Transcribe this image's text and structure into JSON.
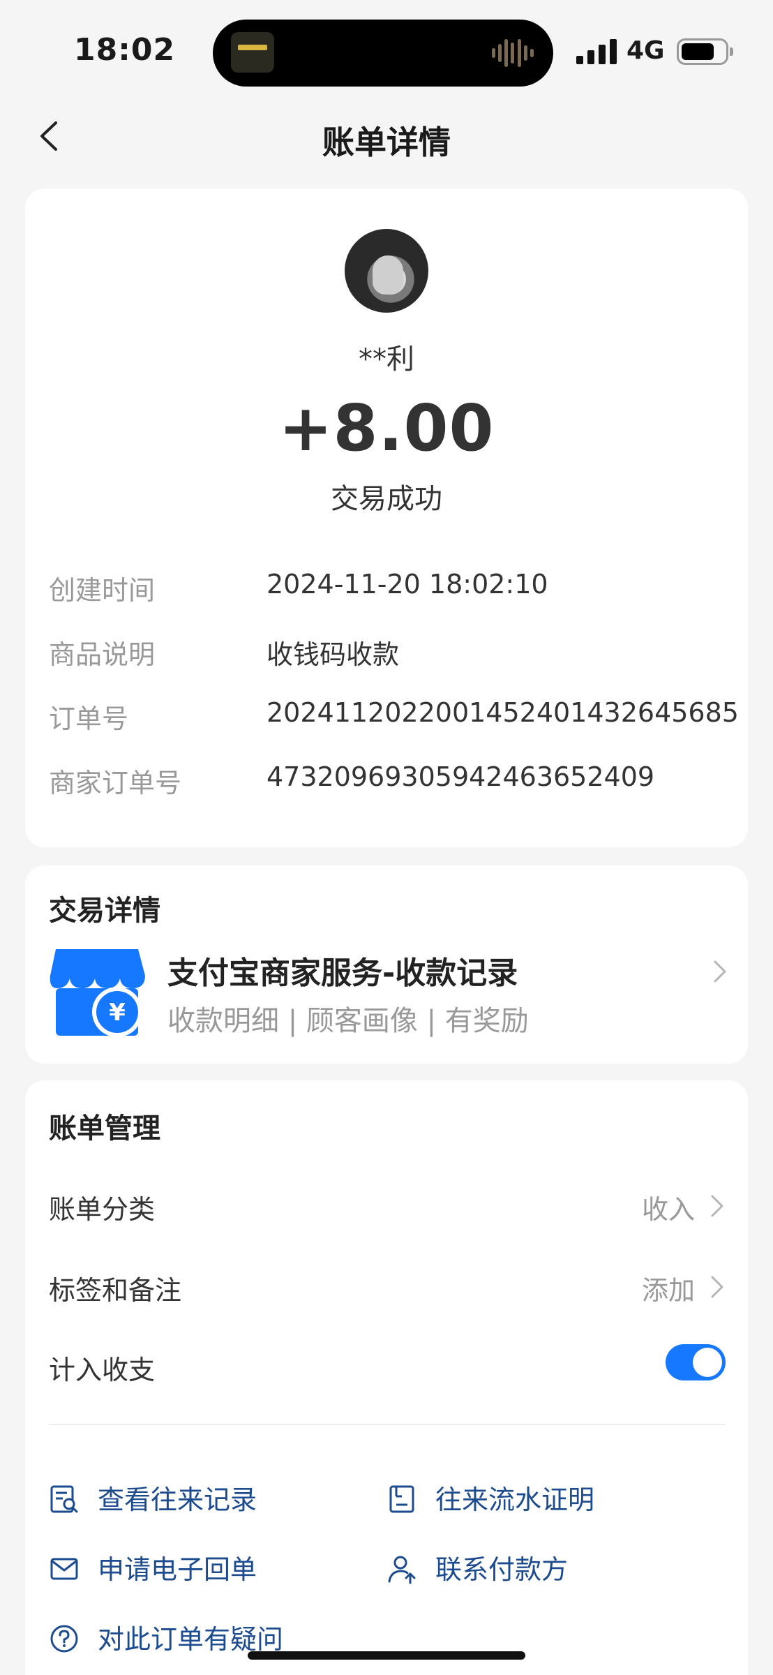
{
  "status_bar": {
    "time": "18:02",
    "network": "4G"
  },
  "nav": {
    "title": "账单详情"
  },
  "summary": {
    "payer": "**利",
    "amount": "+8.00",
    "status": "交易成功"
  },
  "details": [
    {
      "label": "创建时间",
      "value": "2024-11-20 18:02:10"
    },
    {
      "label": "商品说明",
      "value": "收钱码收款"
    },
    {
      "label": "订单号",
      "value": "2024112022001452401432645685"
    },
    {
      "label": "商家订单号",
      "value": "4732096930594246365240​9"
    }
  ],
  "trade": {
    "section_title": "交易详情",
    "service_title": "支付宝商家服务-收款记录",
    "service_sub": "收款明细 | 顾客画像 | 有奖励"
  },
  "manage": {
    "section_title": "账单管理",
    "category_label": "账单分类",
    "category_value": "收入",
    "tags_label": "标签和备注",
    "tags_value": "添加",
    "count_label": "计入收支"
  },
  "actions": {
    "view_records": "查看往来记录",
    "flow_proof": "往来流水证明",
    "e_receipt": "申请电子回单",
    "contact_payer": "联系付款方",
    "question": "对此订单有疑问"
  },
  "colors": {
    "accent": "#1677ff",
    "link": "#1d4b8f",
    "muted": "#999999"
  }
}
